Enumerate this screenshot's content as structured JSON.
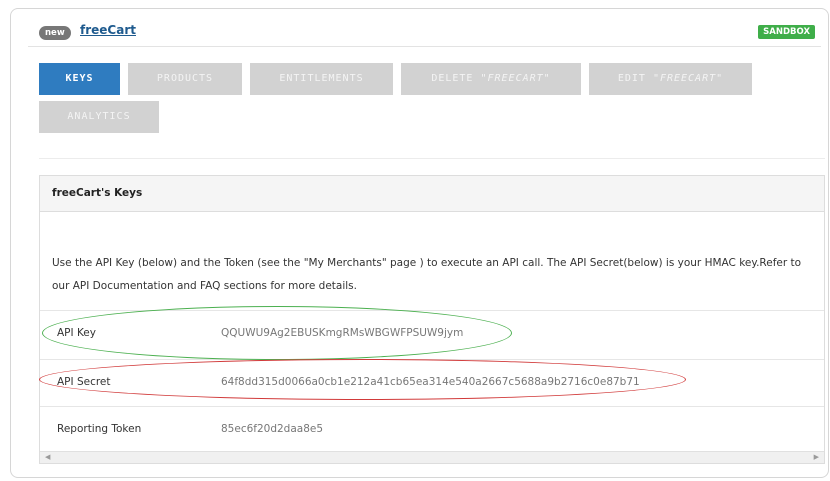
{
  "header": {
    "badge": "new",
    "title": "freeCart",
    "env_badge": "SANDBOX",
    "env_color": "#3fae49"
  },
  "tabs": {
    "keys": "KEYS",
    "products": "PRODUCTS",
    "entitlements": "ENTITLEMENTS",
    "delete_prefix": "DELETE ",
    "delete_name": "\"FREECART\"",
    "edit_prefix": "EDIT ",
    "edit_name": "\"FREECART\"",
    "analytics": "ANALYTICS",
    "active": "KEYS",
    "active_color": "#2f7cc0"
  },
  "panel": {
    "title": "freeCart's Keys",
    "description": "Use the API Key (below) and the Token (see the \"My Merchants\" page ) to execute an API call. The API Secret(below) is your HMAC key.Refer to our API Documentation and FAQ sections for more details.",
    "rows": [
      {
        "label": "API Key",
        "value": "QQUWU9Ag2EBUSKmgRMsWBGWFPSUW9jym"
      },
      {
        "label": "API Secret",
        "value": "64f8dd315d0066a0cb1e212a41cb65ea314e540a2667c5688a9b2716c0e87b71"
      },
      {
        "label": "Reporting Token",
        "value": "85ec6f20d2daa8e5"
      }
    ]
  },
  "annotations": {
    "api_key_highlight_color": "#4cb050",
    "api_secret_highlight_color": "#d13a3a"
  }
}
